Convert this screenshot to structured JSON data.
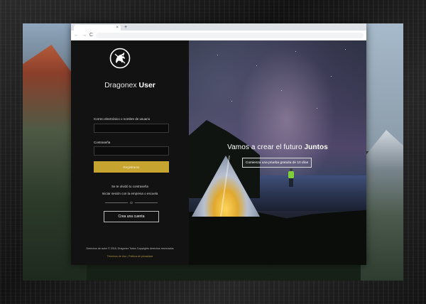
{
  "browser": {
    "new_tab_symbol": "+",
    "tab_close_symbol": "×",
    "back_symbol": "←",
    "forward_symbol": "→",
    "reload_symbol": "C"
  },
  "brand": {
    "name_light": "Dragonex ",
    "name_bold": "User",
    "logo_icon": "dragon-logo-icon"
  },
  "login": {
    "username_label": "Correo electrónico o nombre de usuario",
    "username_value": "",
    "password_label": "Contraseña",
    "password_value": "",
    "submit_label": "Registrarse",
    "forgot_password": "Se te olvidó tu contraseña",
    "company_login": "Iniciar sesión con la empresa o escuela",
    "divider_text": "O",
    "create_account": "Crea una cuenta"
  },
  "footer": {
    "copyright": "Derechos de autor © 2018, Dragonex Todos Copyrights derechos reservados",
    "terms": "Términos de Uso",
    "separator": "|",
    "privacy": "Política de privacidad"
  },
  "hero": {
    "title_light": "Vamos a crear el futuro ",
    "title_bold": "Juntos",
    "trial_button": "Comienza una prueba gratuita de 10 días"
  },
  "colors": {
    "accent": "#c5a52f",
    "panel_bg": "#121212"
  }
}
